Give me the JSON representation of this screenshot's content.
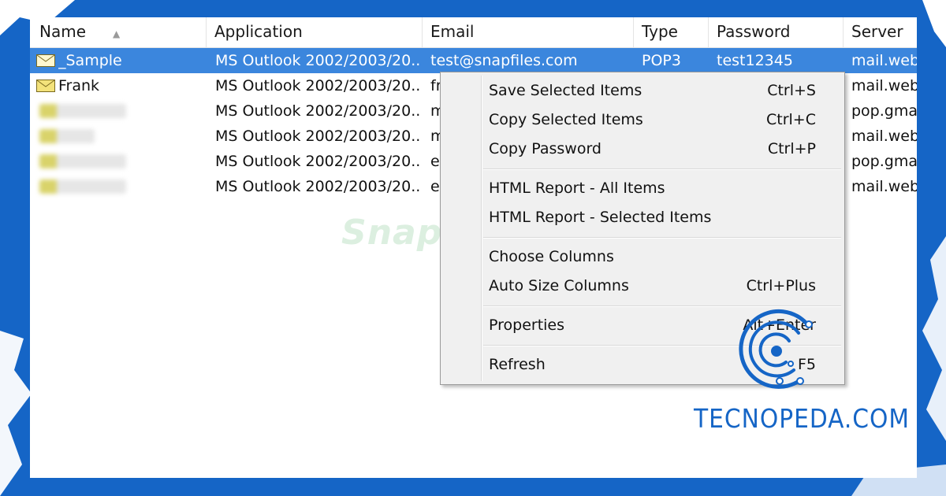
{
  "columns": {
    "name": "Name",
    "application": "Application",
    "email": "Email",
    "type": "Type",
    "password": "Password",
    "server": "Server"
  },
  "rows": [
    {
      "name": "_Sample",
      "application": "MS Outlook 2002/2003/20...",
      "email": "test@snapfiles.com",
      "type": "POP3",
      "password": "test12345",
      "server": "mail.web",
      "selected": true
    },
    {
      "name": "Frank",
      "application": "MS Outlook 2002/2003/20...",
      "email": "fr",
      "type": "",
      "password": "",
      "server": "mail.web"
    },
    {
      "name": "",
      "application": "MS Outlook 2002/2003/20...",
      "email": "m",
      "type": "",
      "password": "",
      "server": "pop.gma"
    },
    {
      "name": "",
      "application": "MS Outlook 2002/2003/20...",
      "email": "m",
      "type": "",
      "password": "",
      "server": "mail.web"
    },
    {
      "name": "",
      "application": "MS Outlook 2002/2003/20...",
      "email": "e",
      "type": "",
      "password": "",
      "server": "pop.gma"
    },
    {
      "name": "",
      "application": "MS Outlook 2002/2003/20...",
      "email": "e",
      "type": "",
      "password": "",
      "server": "mail.web"
    }
  ],
  "context_menu": {
    "items": [
      {
        "label": "Save Selected Items",
        "shortcut": "Ctrl+S"
      },
      {
        "label": "Copy Selected Items",
        "shortcut": "Ctrl+C"
      },
      {
        "label": "Copy Password",
        "shortcut": "Ctrl+P"
      },
      {
        "label": "HTML Report - All Items",
        "shortcut": ""
      },
      {
        "label": "HTML Report - Selected Items",
        "shortcut": ""
      },
      {
        "label": "Choose Columns",
        "shortcut": ""
      },
      {
        "label": "Auto Size Columns",
        "shortcut": "Ctrl+Plus"
      },
      {
        "label": "Properties",
        "shortcut": "Alt+Enter"
      },
      {
        "label": "Refresh",
        "shortcut": "F5"
      }
    ]
  },
  "watermark": "SnapFiles",
  "brand": "TECNOPEDA.COM",
  "icons": {
    "mail": "envelope-icon",
    "logo": "tecnopeda-logo-icon"
  },
  "colors": {
    "accent": "#1565c6",
    "selection": "#3b86dd",
    "menu_bg": "#f0f0f0"
  }
}
